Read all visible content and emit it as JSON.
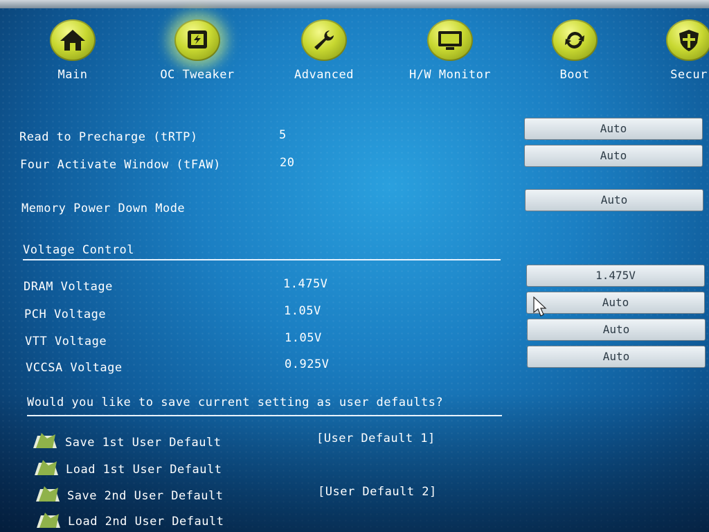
{
  "nav": {
    "items": [
      {
        "label": "Main",
        "icon": "home-icon"
      },
      {
        "label": "OC Tweaker",
        "icon": "oc-chip-icon",
        "active": true
      },
      {
        "label": "Advanced",
        "icon": "wrench-icon"
      },
      {
        "label": "H/W Monitor",
        "icon": "monitor-icon"
      },
      {
        "label": "Boot",
        "icon": "refresh-icon"
      },
      {
        "label": "Secur",
        "icon": "shield-icon"
      }
    ]
  },
  "timing": {
    "trtp": {
      "label": "Read to Precharge (tRTP)",
      "value": "5",
      "setting": "Auto"
    },
    "tfaw": {
      "label": "Four Activate Window (tFAW)",
      "value": "20",
      "setting": "Auto"
    },
    "mpdm": {
      "label": "Memory Power Down Mode",
      "setting": "Auto"
    }
  },
  "voltage": {
    "title": "Voltage Control",
    "dram": {
      "label": "DRAM Voltage",
      "value": "1.475V",
      "setting": "1.475V"
    },
    "pch": {
      "label": "PCH Voltage",
      "value": "1.05V",
      "setting": "Auto"
    },
    "vtt": {
      "label": "VTT Voltage",
      "value": "1.05V",
      "setting": "Auto"
    },
    "vccsa": {
      "label": "VCCSA Voltage",
      "value": "0.925V",
      "setting": "Auto"
    }
  },
  "user_defaults": {
    "title": "Would you like to save current setting as user defaults?",
    "items": [
      {
        "label": "Save 1st User Default",
        "value": "[User Default 1]"
      },
      {
        "label": "Load 1st User Default"
      },
      {
        "label": "Save 2nd User Default",
        "value": "[User Default 2]"
      },
      {
        "label": "Load 2nd User Default"
      }
    ]
  },
  "colors": {
    "accent": "#c8d831",
    "background": "#1b7fc3",
    "button": "#dde4ea"
  }
}
